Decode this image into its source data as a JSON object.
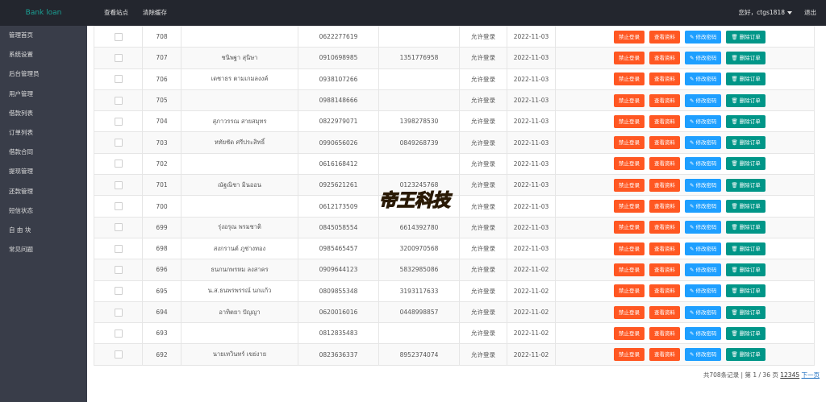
{
  "header": {
    "logo": "Bank loan",
    "nav": [
      "查看站点",
      "清除缓存"
    ],
    "user": "您好，ctgs1818",
    "logout": "退出"
  },
  "sidebar": {
    "items": [
      "管理首页",
      "系统设置",
      "后台管理员",
      "用户管理",
      "借款列表",
      "订单列表",
      "借款合同",
      "提现管理",
      "还款管理",
      "短信状态",
      "自 由 块",
      "常见问题"
    ]
  },
  "actions": {
    "ban": "禁止登录",
    "view": "查看资料",
    "edit_pwd": "修改密码",
    "delete_order": "删除订单"
  },
  "rows": [
    {
      "id": "708",
      "name": "",
      "phone": "0622277619",
      "bank": "",
      "status": "允许登录",
      "date": "2022-11-03"
    },
    {
      "id": "707",
      "name": "ชนิพฐา สุนิษา",
      "phone": "0910698985",
      "bank": "1351776958",
      "status": "允许登录",
      "date": "2022-11-03"
    },
    {
      "id": "706",
      "name": "เดชาธร ตามเกมลงงค์",
      "phone": "0938107266",
      "bank": "",
      "status": "允许登录",
      "date": "2022-11-03"
    },
    {
      "id": "705",
      "name": "",
      "phone": "0988148666",
      "bank": "",
      "status": "允许登录",
      "date": "2022-11-03"
    },
    {
      "id": "704",
      "name": "สุภาวรรณ สายสมุทร",
      "phone": "0822979071",
      "bank": "1398278530",
      "status": "允许登录",
      "date": "2022-11-03"
    },
    {
      "id": "703",
      "name": "หทัยชัด ศรีประสิทธิ์",
      "phone": "0990656026",
      "bank": "0849268739",
      "status": "允许登录",
      "date": "2022-11-03"
    },
    {
      "id": "702",
      "name": "",
      "phone": "0616168412",
      "bank": "",
      "status": "允许登录",
      "date": "2022-11-03"
    },
    {
      "id": "701",
      "name": "ณัฐณิชา มินออน",
      "phone": "0925621261",
      "bank": "0123245768",
      "status": "允许登录",
      "date": "2022-11-03"
    },
    {
      "id": "700",
      "name": "",
      "phone": "0612173509",
      "bank": "",
      "status": "允许登录",
      "date": "2022-11-03"
    },
    {
      "id": "699",
      "name": "รุ่งอรุณ พรมชาติ",
      "phone": "0845058554",
      "bank": "6614392780",
      "status": "允许登录",
      "date": "2022-11-03"
    },
    {
      "id": "698",
      "name": "สงกรานต์ ภูช่างทอง",
      "phone": "0985465457",
      "bank": "3200970568",
      "status": "允许登录",
      "date": "2022-11-03"
    },
    {
      "id": "696",
      "name": "ธนกนกพรหม ลงสาคร",
      "phone": "0909644123",
      "bank": "5832985086",
      "status": "允许登录",
      "date": "2022-11-02"
    },
    {
      "id": "695",
      "name": "น.ส.ธนพรพรรณ์ นกแก้ว",
      "phone": "0809855348",
      "bank": "3193117633",
      "status": "允许登录",
      "date": "2022-11-02"
    },
    {
      "id": "694",
      "name": "อาทิตยา ปัญญา",
      "phone": "0620016016",
      "bank": "0448998857",
      "status": "允许登录",
      "date": "2022-11-02"
    },
    {
      "id": "693",
      "name": "",
      "phone": "0812835483",
      "bank": "",
      "status": "允许登录",
      "date": "2022-11-02"
    },
    {
      "id": "692",
      "name": "นายเทวินทร์ เขย่งาย",
      "phone": "0823636337",
      "bank": "8952374074",
      "status": "允许登录",
      "date": "2022-11-02"
    }
  ],
  "pager": {
    "summary": "共708条记录 | 第 1 / 36 页",
    "pages": "12345",
    "next": "下一页"
  },
  "watermark_text": "帝王科技",
  "colors": {
    "topbar": "#23262e",
    "sidebar": "#393d49",
    "logo": "#1aa094",
    "btn_red": "#ff5722",
    "btn_blue": "#1e9fff",
    "btn_green": "#009688"
  }
}
